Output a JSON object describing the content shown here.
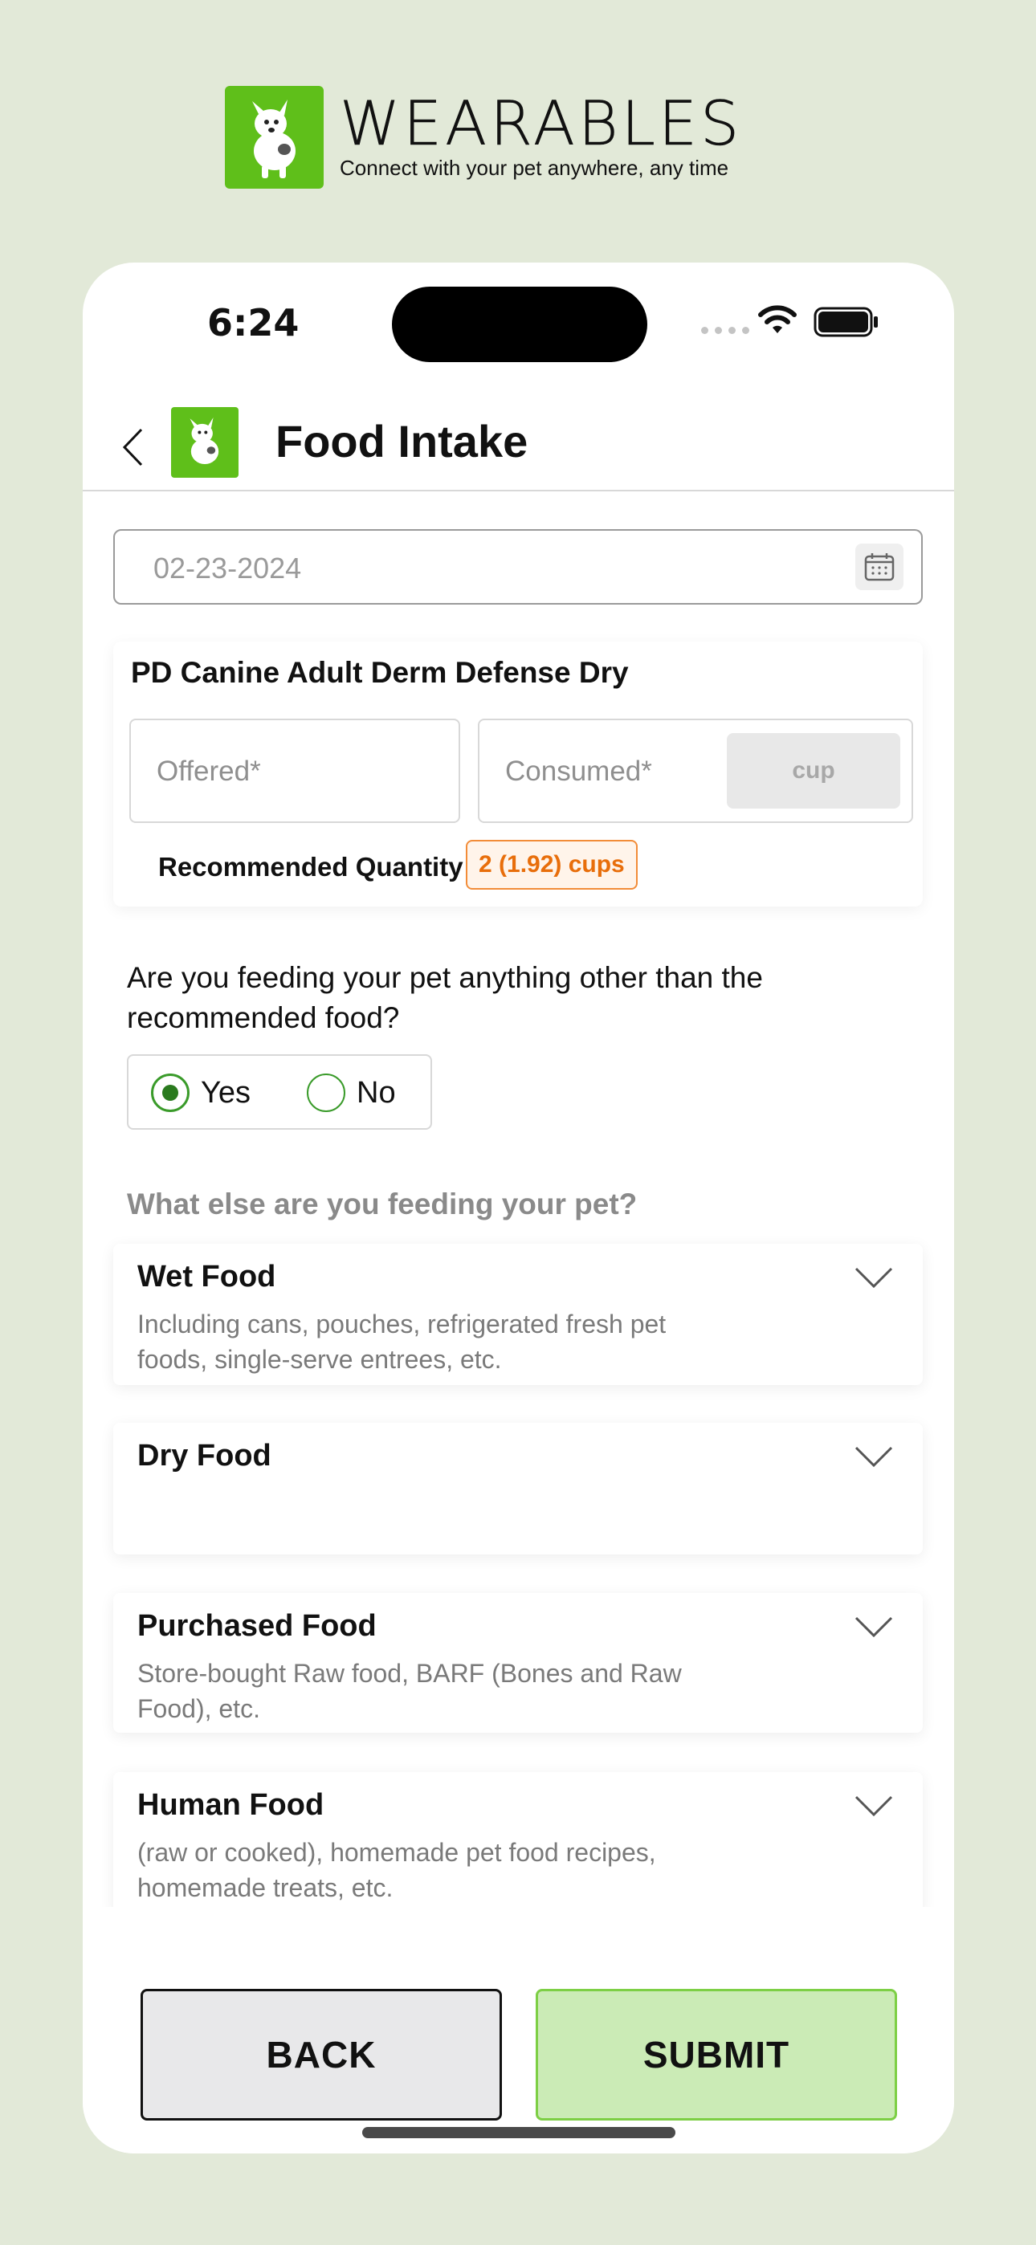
{
  "brand": {
    "name": "WEARABLES",
    "tagline": "Connect with your pet anywhere, any time",
    "accent_color": "#5fbf1a"
  },
  "status_bar": {
    "time": "6:24"
  },
  "nav": {
    "title": "Food Intake"
  },
  "date_field": {
    "value": "02-23-2024",
    "icon": "calendar-icon"
  },
  "food_card": {
    "name": "PD Canine Adult Derm Defense Dry",
    "offered_placeholder": "Offered*",
    "consumed_placeholder": "Consumed*",
    "unit": "cup",
    "recommended_label": "Recommended Quantity",
    "recommended_value": "2  (1.92) cups"
  },
  "question": {
    "text": "Are you feeding your pet anything other than the recommended food?",
    "options": [
      {
        "label": "Yes",
        "selected": true
      },
      {
        "label": "No",
        "selected": false
      }
    ]
  },
  "other_food": {
    "heading": "What else are you feeding your pet?",
    "categories": [
      {
        "title": "Wet Food",
        "description": "Including cans, pouches, refrigerated fresh pet foods, single-serve entrees, etc."
      },
      {
        "title": "Dry Food",
        "description": ""
      },
      {
        "title": "Purchased Food",
        "description": "Store-bought Raw food, BARF (Bones and Raw Food), etc."
      },
      {
        "title": "Human Food",
        "description": "(raw or cooked), homemade pet food recipes, homemade treats, etc."
      }
    ]
  },
  "actions": {
    "back_label": "BACK",
    "submit_label": "SUBMIT"
  }
}
